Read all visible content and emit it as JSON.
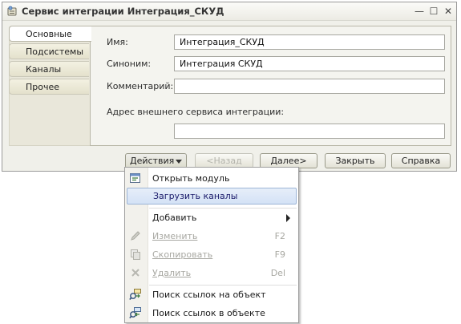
{
  "window": {
    "title": "Сервис интеграции Интеграция_СКУД",
    "minimize_symbol": "—",
    "maximize_symbol": "☐",
    "close_symbol": "✕"
  },
  "tabs": [
    {
      "label": "Основные",
      "active": true
    },
    {
      "label": "Подсистемы",
      "active": false
    },
    {
      "label": "Каналы",
      "active": false
    },
    {
      "label": "Прочее",
      "active": false
    }
  ],
  "form": {
    "name_label": "Имя:",
    "name_value": "Интеграция_СКУД",
    "synonym_label": "Синоним:",
    "synonym_value": "Интеграция СКУД",
    "comment_label": "Комментарий:",
    "comment_value": "",
    "address_label": "Адрес внешнего сервиса интеграции:",
    "address_value": ""
  },
  "buttons": {
    "actions": "Действия",
    "back": "<Назад",
    "next": "Далее>",
    "close": "Закрыть",
    "help": "Справка"
  },
  "menu": {
    "items": [
      {
        "label": "Открыть модуль",
        "shortcut": "",
        "icon": "module-icon",
        "enabled": true
      },
      {
        "label": "Загрузить каналы",
        "shortcut": "",
        "icon": "",
        "enabled": true,
        "highlighted": true
      },
      {
        "label": "Добавить",
        "shortcut": "",
        "icon": "",
        "enabled": true,
        "submenu": true
      },
      {
        "label": "Изменить",
        "shortcut": "F2",
        "icon": "pencil-icon",
        "enabled": false
      },
      {
        "label": "Скопировать",
        "shortcut": "F9",
        "icon": "copy-icon",
        "enabled": false
      },
      {
        "label": "Удалить",
        "shortcut": "Del",
        "icon": "delete-icon",
        "enabled": false
      },
      {
        "label": "Поиск ссылок на объект",
        "shortcut": "",
        "icon": "find-refs-to-icon",
        "enabled": true
      },
      {
        "label": "Поиск ссылок в объекте",
        "shortcut": "",
        "icon": "find-refs-in-icon",
        "enabled": true
      }
    ]
  },
  "colors": {
    "window_bg": "#f0f0ea",
    "highlight_bg": "#d4e2f6",
    "disabled_text": "#a8a8a2"
  }
}
